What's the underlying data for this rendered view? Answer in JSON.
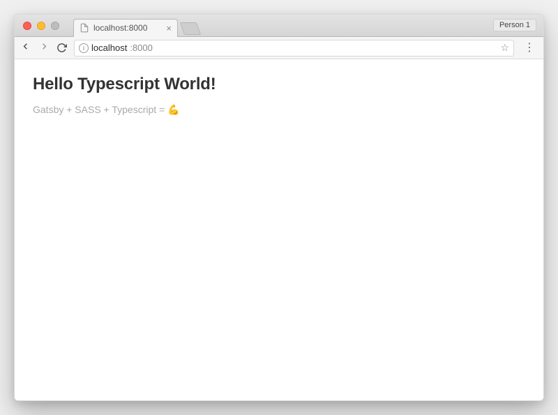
{
  "window": {
    "profile_label": "Person 1"
  },
  "tab": {
    "title": "localhost:8000"
  },
  "address_bar": {
    "host": "localhost",
    "port": ":8000"
  },
  "page": {
    "heading": "Hello Typescript World!",
    "subtext": "Gatsby + SASS + Typescript = ",
    "emoji": "💪"
  }
}
